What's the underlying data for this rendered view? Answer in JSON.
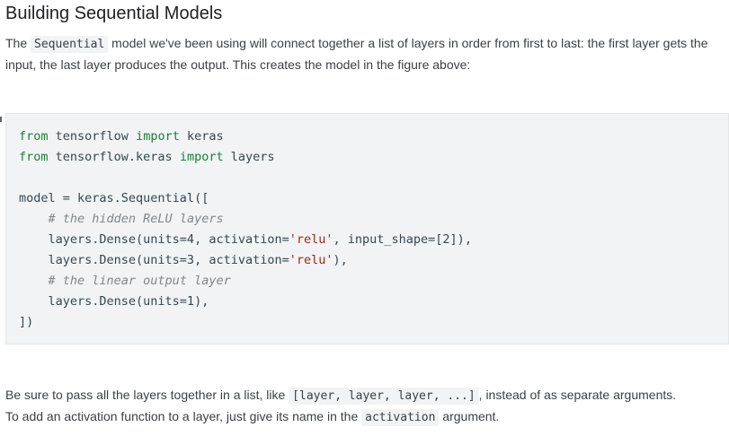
{
  "heading": "Building Sequential Models",
  "para1": {
    "pre": "The ",
    "code": "Sequential",
    "post": " model we've been using will connect together a list of layers in order from first to last: the first layer gets the input, the last layer produces the output. This creates the model in the figure above:"
  },
  "code_lines": [
    [
      {
        "t": "from",
        "c": "kw"
      },
      {
        "t": " tensorflow ",
        "c": "op"
      },
      {
        "t": "import",
        "c": "kw"
      },
      {
        "t": " keras",
        "c": "op"
      }
    ],
    [
      {
        "t": "from",
        "c": "kw"
      },
      {
        "t": " tensorflow.keras ",
        "c": "op"
      },
      {
        "t": "import",
        "c": "kw"
      },
      {
        "t": " layers",
        "c": "op"
      }
    ],
    [],
    [
      {
        "t": "model = keras.Sequential([",
        "c": "op"
      }
    ],
    [
      {
        "t": "    ",
        "c": "op"
      },
      {
        "t": "# the hidden ReLU layers",
        "c": "cm"
      }
    ],
    [
      {
        "t": "    layers.Dense(units=4, activation=",
        "c": "op"
      },
      {
        "t": "'relu'",
        "c": "str"
      },
      {
        "t": ", input_shape=[2]),",
        "c": "op"
      }
    ],
    [
      {
        "t": "    layers.Dense(units=3, activation=",
        "c": "op"
      },
      {
        "t": "'relu'",
        "c": "str"
      },
      {
        "t": "),",
        "c": "op"
      }
    ],
    [
      {
        "t": "    ",
        "c": "op"
      },
      {
        "t": "# the linear output layer",
        "c": "cm"
      }
    ],
    [
      {
        "t": "    layers.Dense(units=1),",
        "c": "op"
      }
    ],
    [
      {
        "t": "])",
        "c": "op"
      }
    ]
  ],
  "para2": {
    "s1_pre": "Be sure to pass all the layers together in a list, like ",
    "s1_code": "[layer, layer, layer, ...]",
    "s1_post": ", instead of as separate arguments.",
    "s2_pre": "To add an activation function to a layer, just give its name in the ",
    "s2_code": "activation",
    "s2_post": " argument."
  }
}
